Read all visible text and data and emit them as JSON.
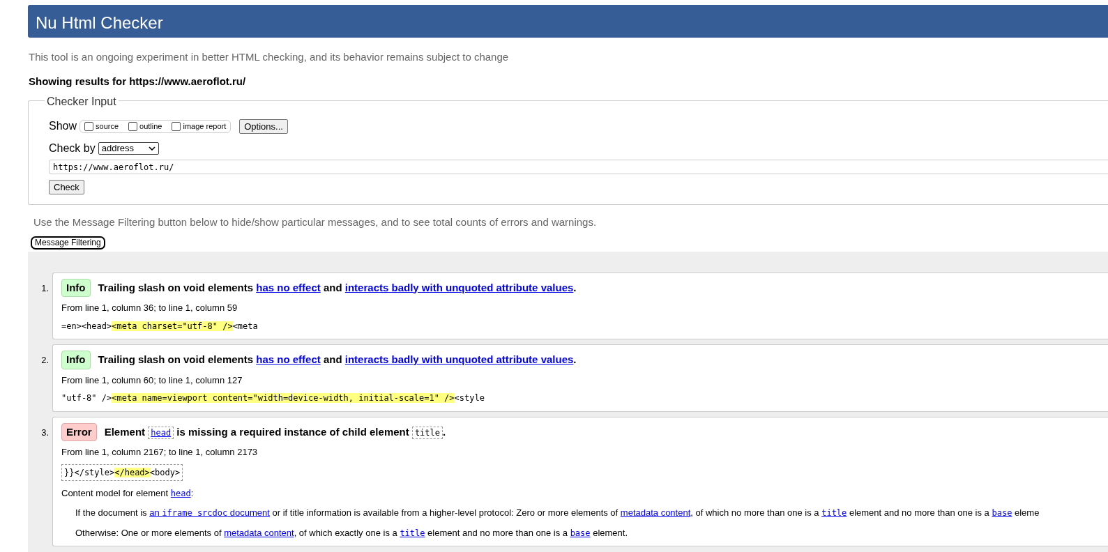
{
  "header": {
    "title": "Nu Html Checker"
  },
  "intro": "This tool is an ongoing experiment in better HTML checking, and its behavior remains subject to change",
  "results_heading": "Showing results for https://www.aeroflot.ru/",
  "checker_input": {
    "legend": "Checker Input",
    "show_label": "Show",
    "show_options": [
      {
        "label": "source",
        "checked": false
      },
      {
        "label": "outline",
        "checked": false
      },
      {
        "label": "image report",
        "checked": false
      }
    ],
    "options_button": "Options...",
    "check_by_label": "Check by",
    "check_by_value": "address",
    "url_value": "https://www.aeroflot.ru/",
    "check_button": "Check"
  },
  "filter_note": "Use the Message Filtering button below to hide/show particular messages, and to see total counts of errors and warnings.",
  "filter_button": "Message Filtering",
  "messages": [
    {
      "number": "1.",
      "kind": "info",
      "badge": "Info",
      "title": [
        {
          "kind": "text",
          "text": "Trailing slash on void elements "
        },
        {
          "kind": "link",
          "text": "has no effect"
        },
        {
          "kind": "text",
          "text": " and "
        },
        {
          "kind": "link",
          "text": "interacts badly with unquoted attribute values"
        },
        {
          "kind": "text",
          "text": "."
        }
      ],
      "location": "From line 1, column 36; to line 1, column 59",
      "boxed_extract": false,
      "extract": [
        {
          "kind": "text",
          "text": "=en><head>"
        },
        {
          "kind": "highlight",
          "text": "<meta charset=\"utf-8\" />"
        },
        {
          "kind": "text",
          "text": "<meta"
        }
      ]
    },
    {
      "number": "2.",
      "kind": "info",
      "badge": "Info",
      "title": [
        {
          "kind": "text",
          "text": "Trailing slash on void elements "
        },
        {
          "kind": "link",
          "text": "has no effect"
        },
        {
          "kind": "text",
          "text": " and "
        },
        {
          "kind": "link",
          "text": "interacts badly with unquoted attribute values"
        },
        {
          "kind": "text",
          "text": "."
        }
      ],
      "location": "From line 1, column 60; to line 1, column 127",
      "boxed_extract": false,
      "extract": [
        {
          "kind": "text",
          "text": "\"utf-8\" />"
        },
        {
          "kind": "highlight",
          "text": "<meta name=viewport content=\"width=device-width, initial-scale=1\" />"
        },
        {
          "kind": "text",
          "text": "<style"
        }
      ]
    },
    {
      "number": "3.",
      "kind": "error",
      "badge": "Error",
      "title": [
        {
          "kind": "text",
          "text": "Element "
        },
        {
          "kind": "boxed_link_code",
          "text": "head"
        },
        {
          "kind": "text",
          "text": " is missing a required instance of child element "
        },
        {
          "kind": "boxed_code",
          "text": "title"
        },
        {
          "kind": "text",
          "text": "."
        }
      ],
      "location": "From line 1, column 2167; to line 1, column 2173",
      "boxed_extract": true,
      "extract": [
        {
          "kind": "text",
          "text": "}}</style>"
        },
        {
          "kind": "highlight",
          "text": "</head>"
        },
        {
          "kind": "text",
          "text": "<body>"
        }
      ],
      "details": [
        {
          "indent": false,
          "segments": [
            {
              "kind": "text",
              "text": "Content model for element "
            },
            {
              "kind": "link_code",
              "text": "head"
            },
            {
              "kind": "text",
              "text": ":"
            }
          ]
        },
        {
          "indent": true,
          "segments": [
            {
              "kind": "text",
              "text": "If the document is "
            },
            {
              "kind": "link_mixed",
              "parts": [
                {
                  "kind": "text",
                  "text": "an "
                },
                {
                  "kind": "code",
                  "text": "iframe srcdoc"
                },
                {
                  "kind": "text",
                  "text": " document"
                }
              ]
            },
            {
              "kind": "text",
              "text": " or if title information is available from a higher-level protocol: Zero or more elements of "
            },
            {
              "kind": "link",
              "text": "metadata content"
            },
            {
              "kind": "text",
              "text": ", of which no more than one is a "
            },
            {
              "kind": "link_code",
              "text": "title"
            },
            {
              "kind": "text",
              "text": " element and no more than one is a "
            },
            {
              "kind": "link_code",
              "text": "base"
            },
            {
              "kind": "text",
              "text": " eleme"
            }
          ]
        },
        {
          "indent": true,
          "segments": [
            {
              "kind": "text",
              "text": "Otherwise: One or more elements of "
            },
            {
              "kind": "link",
              "text": "metadata content"
            },
            {
              "kind": "text",
              "text": ", of which exactly one is a "
            },
            {
              "kind": "link_code",
              "text": "title"
            },
            {
              "kind": "text",
              "text": " element and no more than one is a "
            },
            {
              "kind": "link_code",
              "text": "base"
            },
            {
              "kind": "text",
              "text": " element."
            }
          ]
        }
      ]
    }
  ]
}
